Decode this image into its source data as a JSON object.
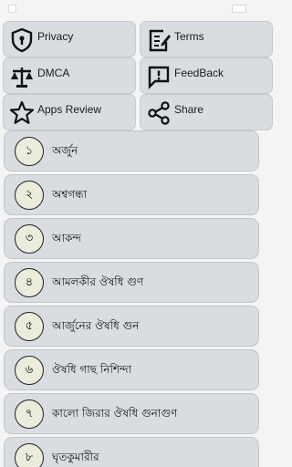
{
  "menu": [
    {
      "label": "Privacy",
      "icon": "shield-icon"
    },
    {
      "label": "Terms",
      "icon": "edit-document-icon"
    },
    {
      "label": "DMCA",
      "icon": "scale-icon"
    },
    {
      "label": "FeedBack",
      "icon": "feedback-icon"
    },
    {
      "label": "Apps Review",
      "icon": "star-icon"
    },
    {
      "label": "Share",
      "icon": "share-icon"
    }
  ],
  "items": [
    {
      "num": "১",
      "title": "অর্জুন"
    },
    {
      "num": "২",
      "title": "অশ্বগন্ধা"
    },
    {
      "num": "৩",
      "title": "আকন্দ"
    },
    {
      "num": "৪",
      "title": "আমলকীর ঔষধি গুণ"
    },
    {
      "num": "৫",
      "title": "আর্জুনের ঔষধি গুন"
    },
    {
      "num": "৬",
      "title": "ঔষধি গাছ নিশিন্দা"
    },
    {
      "num": "৭",
      "title": "কালো জিরার ঔষধি গুনাগুণ"
    },
    {
      "num": "৮",
      "title": "ঘৃতকুমারীর"
    }
  ]
}
